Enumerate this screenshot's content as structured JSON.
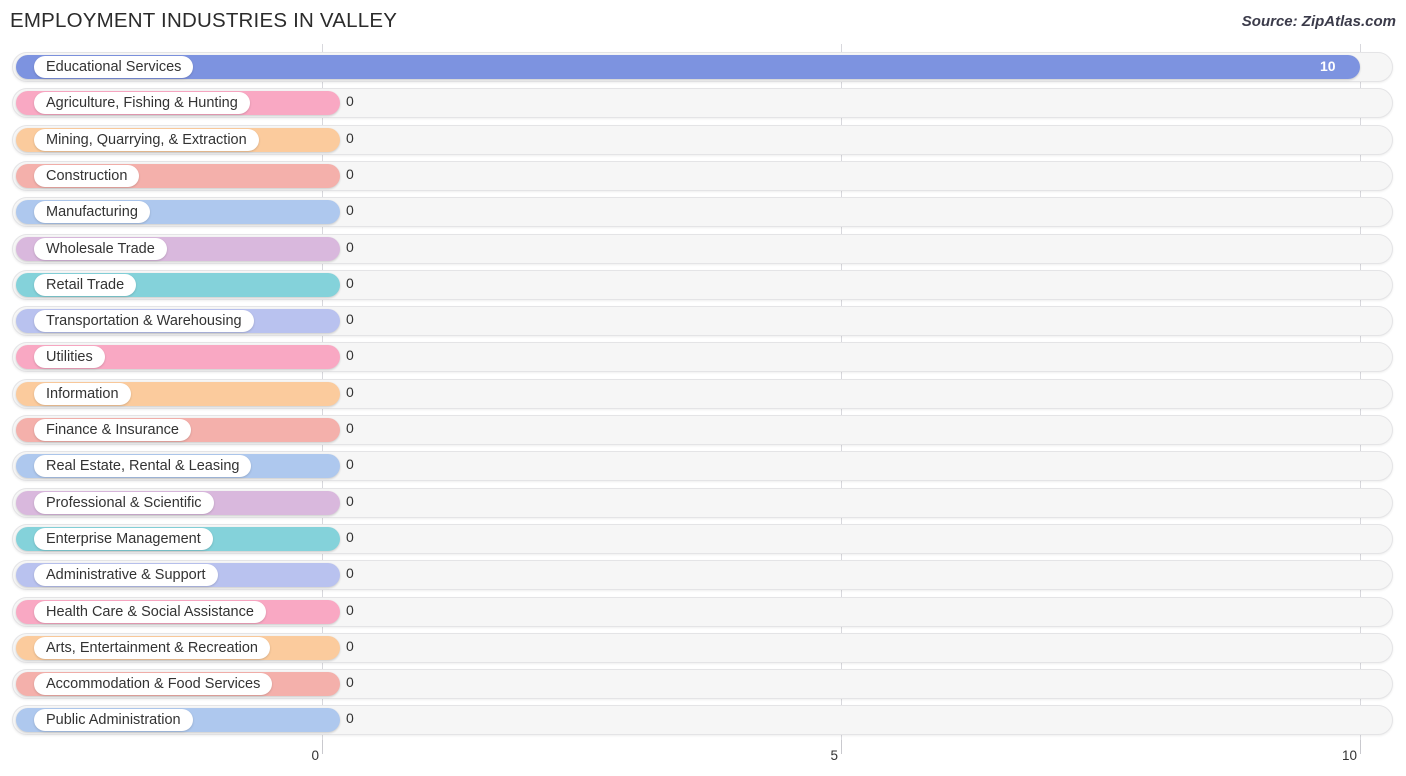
{
  "header": {
    "title": "EMPLOYMENT INDUSTRIES IN VALLEY",
    "source": "Source: ZipAtlas.com"
  },
  "chart_data": {
    "type": "bar",
    "orientation": "horizontal",
    "title": "EMPLOYMENT INDUSTRIES IN VALLEY",
    "xlabel": "",
    "ylabel": "",
    "xlim": [
      0,
      10
    ],
    "grid": true,
    "legend": "none",
    "xticks": [
      "0",
      "5",
      "10"
    ],
    "xtick_values": [
      0,
      5,
      10
    ],
    "categories": [
      "Educational Services",
      "Agriculture, Fishing & Hunting",
      "Mining, Quarrying, & Extraction",
      "Construction",
      "Manufacturing",
      "Wholesale Trade",
      "Retail Trade",
      "Transportation & Warehousing",
      "Utilities",
      "Information",
      "Finance & Insurance",
      "Real Estate, Rental & Leasing",
      "Professional & Scientific",
      "Enterprise Management",
      "Administrative & Support",
      "Health Care & Social Assistance",
      "Arts, Entertainment & Recreation",
      "Accommodation & Food Services",
      "Public Administration"
    ],
    "values": [
      10,
      0,
      0,
      0,
      0,
      0,
      0,
      0,
      0,
      0,
      0,
      0,
      0,
      0,
      0,
      0,
      0,
      0,
      0
    ],
    "value_labels": [
      "10",
      "0",
      "0",
      "0",
      "0",
      "0",
      "0",
      "0",
      "0",
      "0",
      "0",
      "0",
      "0",
      "0",
      "0",
      "0",
      "0",
      "0",
      "0"
    ],
    "colors": [
      "#7d93e0",
      "#f9a8c3",
      "#fbcb9d",
      "#f4b0ab",
      "#aec8ee",
      "#d9b8dd",
      "#84d2da",
      "#b9c2ef",
      "#f9a8c3",
      "#fbcb9d",
      "#f4b0ab",
      "#aec8ee",
      "#d9b8dd",
      "#84d2da",
      "#b9c2ef",
      "#f9a8c3",
      "#fbcb9d",
      "#f4b0ab",
      "#aec8ee"
    ]
  }
}
